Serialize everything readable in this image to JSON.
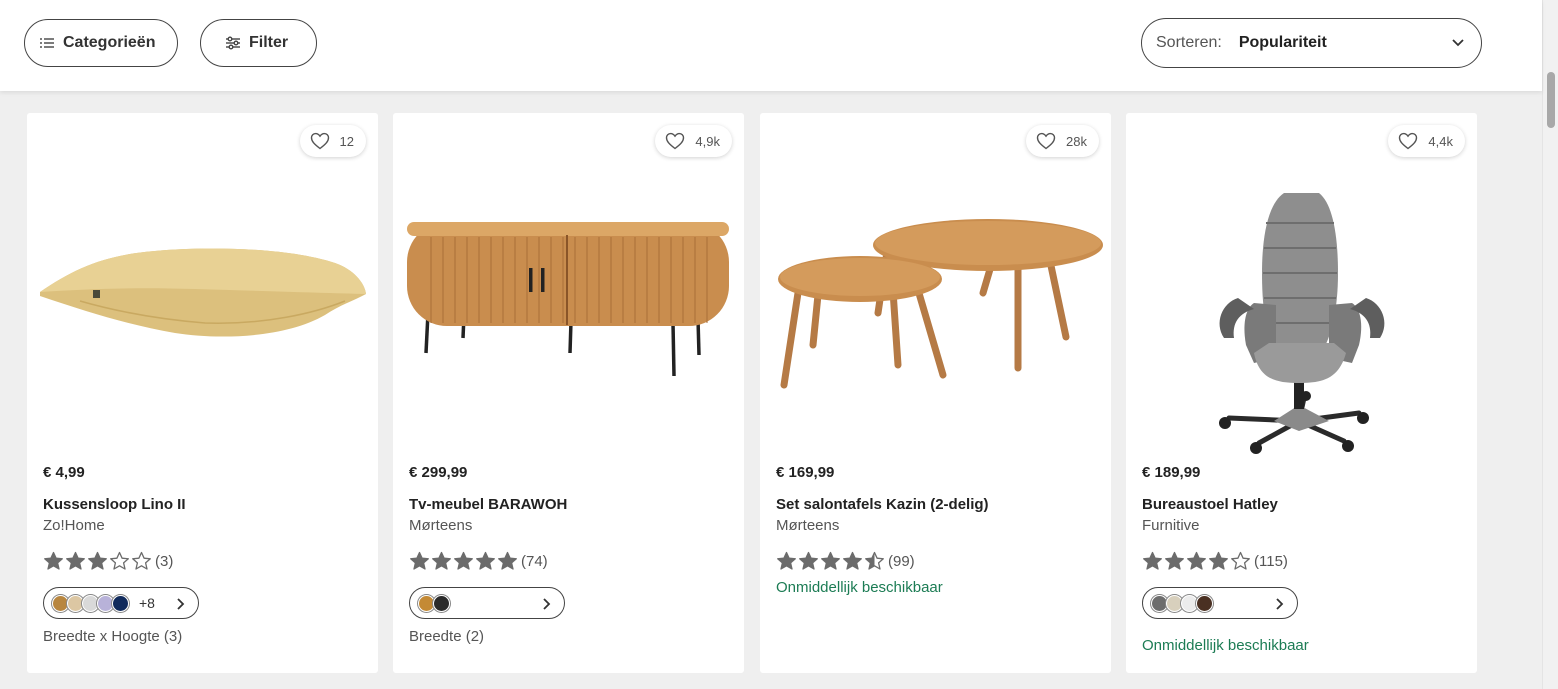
{
  "toolbar": {
    "categories_label": "Categorieën",
    "filter_label": "Filter",
    "sort_label": "Sorteren:",
    "sort_value": "Populariteit"
  },
  "products": [
    {
      "favorites": "12",
      "price": "€ 4,99",
      "title": "Kussensloop Lino II",
      "brand": "Zo!Home",
      "rating": 3,
      "reviews": "(3)",
      "swatch_more": "+8",
      "variant": "Breedte x Hoogte (3)",
      "swatch_colors": [
        "#b8863f",
        "#dcc7a3",
        "#d9d9d9",
        "#b8b2d9",
        "#102a5c"
      ]
    },
    {
      "favorites": "4,9k",
      "price": "€ 299,99",
      "title": "Tv-meubel BARAWOH",
      "brand": "Mørteens",
      "rating": 5,
      "reviews": "(74)",
      "variant": "Breedte (2)",
      "swatch_colors": [
        "#c48a35",
        "#2a2a2a"
      ]
    },
    {
      "favorites": "28k",
      "price": "€ 169,99",
      "title": "Set salontafels Kazin (2-delig)",
      "brand": "Mørteens",
      "rating": 4.5,
      "reviews": "(99)",
      "availability": "Onmiddellijk beschikbaar"
    },
    {
      "favorites": "4,4k",
      "price": "€ 189,99",
      "title": "Bureaustoel Hatley",
      "brand": "Furnitive",
      "rating": 4,
      "reviews": "(115)",
      "availability": "Onmiddellijk beschikbaar",
      "swatch_colors": [
        "#6d6d6d",
        "#d8d0bd",
        "#ececec",
        "#4a3022"
      ]
    }
  ],
  "colors": {
    "availability": "#1c7c54",
    "star": "#6b6b6b"
  }
}
